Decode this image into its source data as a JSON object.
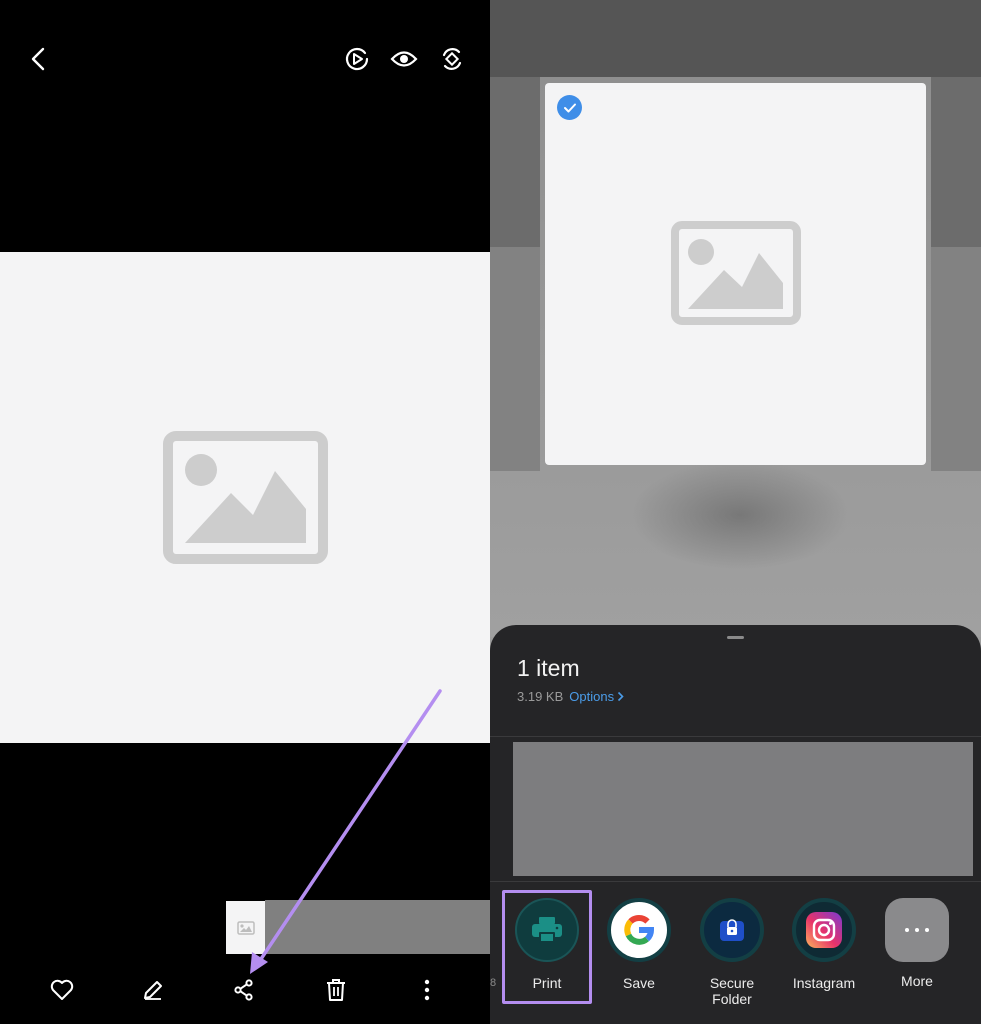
{
  "viewer": {
    "top_icons": [
      "back-icon",
      "motion-photo-icon",
      "eye-icon",
      "rotate-icon"
    ],
    "bottom_icons": [
      "heart-icon",
      "edit-pencil-icon",
      "share-icon",
      "trash-icon",
      "more-vertical-icon"
    ]
  },
  "share_sheet": {
    "title": "1 item",
    "size": "3.19 KB",
    "options_label": "Options",
    "apps": [
      {
        "label": "Print",
        "icon": "printer-icon",
        "color": "#1b8f86"
      },
      {
        "label": "Save",
        "icon": "google-icon",
        "color": "#ffffff"
      },
      {
        "label": "Secure\nFolder",
        "icon": "secure-folder-icon",
        "color": "#1f4fc8"
      },
      {
        "label": "Instagram",
        "icon": "instagram-icon",
        "color": "#d6249f"
      },
      {
        "label": "More",
        "icon": "more-dots-icon",
        "color": "#8a8a8c"
      }
    ],
    "edge_digit": "8"
  },
  "colors": {
    "accent_link": "#4b9ce8",
    "check": "#3f8ee8",
    "highlight": "#b48ef0"
  }
}
